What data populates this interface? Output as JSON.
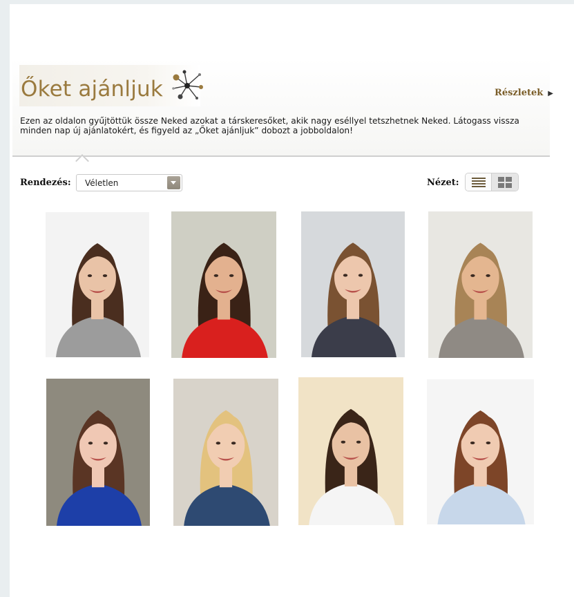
{
  "header": {
    "title": "Őket ajánljuk",
    "details_link": "Részletek",
    "intro_text": "Ezen az oldalon gyűjtöttük össze Neked azokat a társkeresőket, akik nagy eséllyel tetszhetnek Neked. Látogass vissza minden nap új ajánlatokért, és figyeld az „Őket ajánljuk” dobozt a jobboldalon!"
  },
  "controls": {
    "sort_label": "Rendezés:",
    "sort_value": "Véletlen",
    "view_label": "Nézet:",
    "view_modes": [
      "list-icon",
      "grid-icon"
    ],
    "active_view": "grid"
  },
  "profiles": [
    {
      "id": 1,
      "bg": "#f3f3f3",
      "hair": "#4a2e1f",
      "skin": "#e9c3a7",
      "top": "#9c9c9c"
    },
    {
      "id": 2,
      "bg": "#cfcfc4",
      "hair": "#3a2216",
      "skin": "#e3b18f",
      "top": "#d9201e"
    },
    {
      "id": 3,
      "bg": "#d6d9dc",
      "hair": "#7a5232",
      "skin": "#edc7ad",
      "top": "#3b3d4a"
    },
    {
      "id": 4,
      "bg": "#e8e7e2",
      "hair": "#a88456",
      "skin": "#e4b690",
      "top": "#8f8a84"
    },
    {
      "id": 5,
      "bg": "#8e8a7e",
      "hair": "#5a3524",
      "skin": "#f0c8b4",
      "top": "#1d3fa8"
    },
    {
      "id": 6,
      "bg": "#d8d3ca",
      "hair": "#e3c27e",
      "skin": "#f1cdb2",
      "top": "#2e4a72"
    },
    {
      "id": 7,
      "bg": "#f1e3c6",
      "hair": "#3a2518",
      "skin": "#e9c2a4",
      "top": "#f5f5f5"
    },
    {
      "id": 8,
      "bg": "#f5f5f5",
      "hair": "#7d4528",
      "skin": "#f0cbb2",
      "top": "#c7d7ea"
    }
  ]
}
